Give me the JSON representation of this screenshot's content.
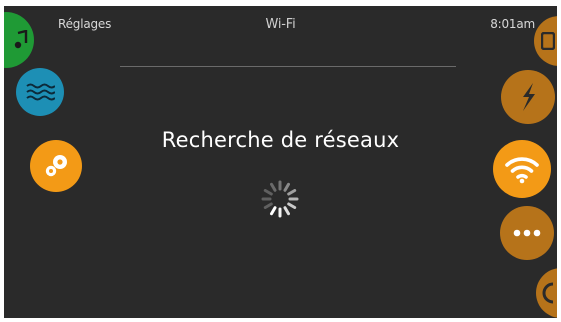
{
  "header": {
    "app_title": "Réglages",
    "page_title": "Wi-Fi",
    "time": "8:01am"
  },
  "main": {
    "status_message": "Recherche de réseaux"
  },
  "icons": {
    "left": [
      "music-icon",
      "water-icon",
      "gears-icon"
    ],
    "right": [
      "clock-icon",
      "lightning-icon",
      "wifi-icon",
      "more-icon",
      "power-icon"
    ]
  },
  "colors": {
    "background": "#2a2a2a",
    "green": "#1f9a35",
    "blue": "#1d8fb5",
    "orange": "#f39a16",
    "orange_dim": "#b6731a",
    "text": "#ffffff"
  }
}
